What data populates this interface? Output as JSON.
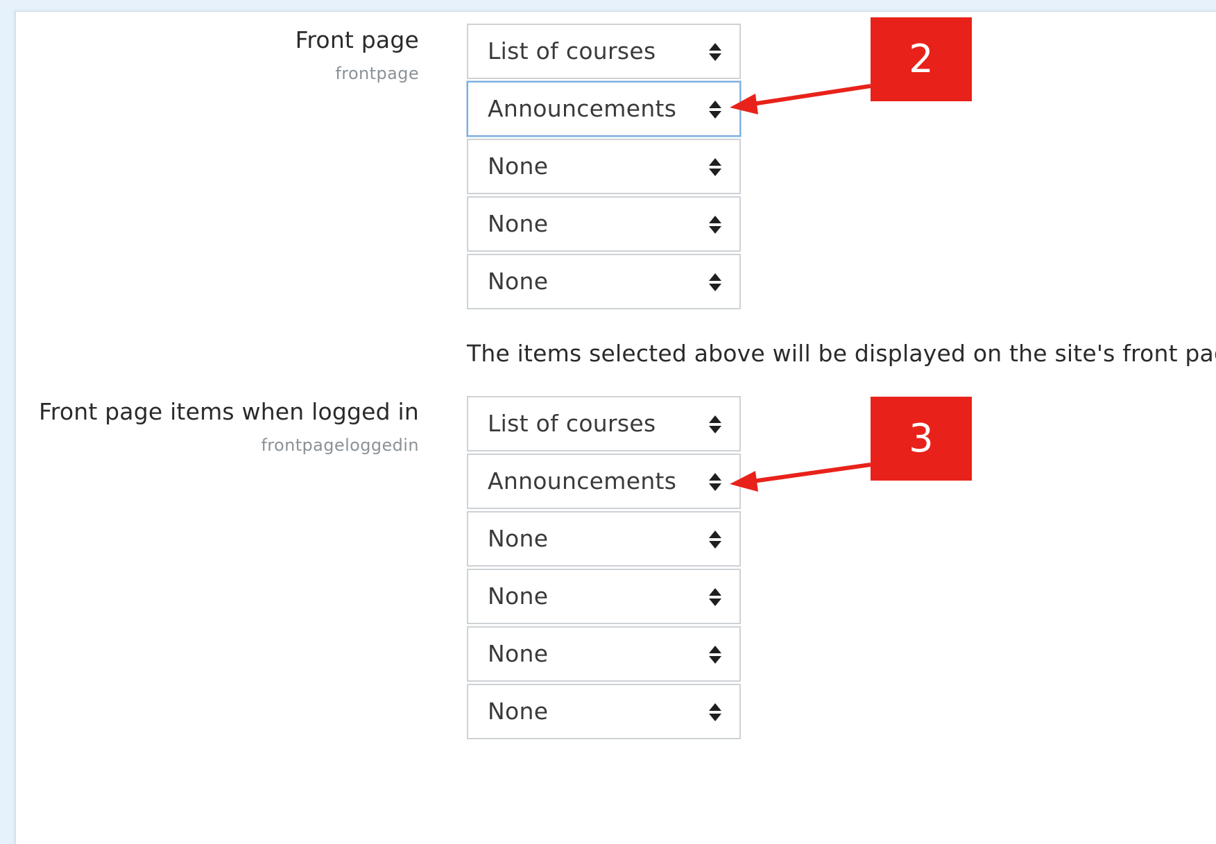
{
  "front_page": {
    "label": "Front page",
    "key": "frontpage",
    "selects": [
      {
        "value": "List of courses",
        "focused": false
      },
      {
        "value": "Announcements",
        "focused": true
      },
      {
        "value": "None",
        "focused": false
      },
      {
        "value": "None",
        "focused": false
      },
      {
        "value": "None",
        "focused": false
      }
    ],
    "description": "The items selected above will be displayed on the site's front page."
  },
  "front_page_logged_in": {
    "label": "Front page items when logged in",
    "key": "frontpageloggedin",
    "selects": [
      {
        "value": "List of courses",
        "focused": false
      },
      {
        "value": "Announcements",
        "focused": false
      },
      {
        "value": "None",
        "focused": false
      },
      {
        "value": "None",
        "focused": false
      },
      {
        "value": "None",
        "focused": false
      },
      {
        "value": "None",
        "focused": false
      }
    ]
  },
  "callouts": [
    {
      "number": "2"
    },
    {
      "number": "3"
    }
  ],
  "colors": {
    "callout": "#e8221a",
    "focus_border": "#7fb0e0",
    "select_border": "#cdd2d6"
  }
}
